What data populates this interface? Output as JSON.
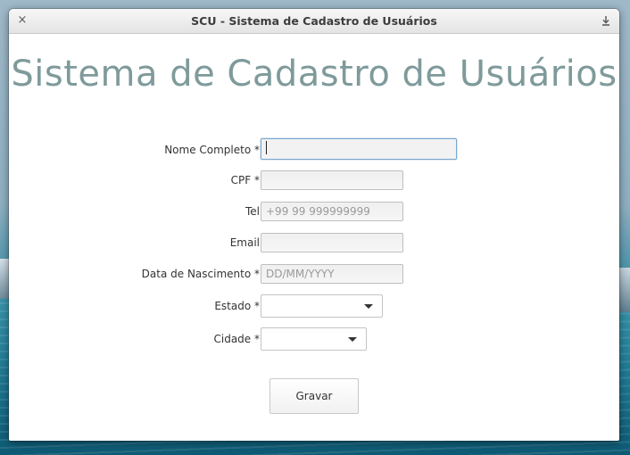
{
  "window": {
    "title": "SCU - Sistema de Cadastro de Usuários",
    "close_glyph": "×",
    "close_icon": "close-icon",
    "maximize_icon": "maximize-icon"
  },
  "heading": "Sistema de Cadastro de Usuários",
  "form": {
    "nome": {
      "label": "Nome Completo *",
      "value": "",
      "focused": true
    },
    "cpf": {
      "label": "CPF *",
      "value": ""
    },
    "tel": {
      "label": "Tel",
      "placeholder": "+99 99 999999999"
    },
    "email": {
      "label": "Email",
      "value": ""
    },
    "nascimento": {
      "label": "Data de Nascimento *",
      "placeholder": "DD/MM/YYYY"
    },
    "estado": {
      "label": "Estado *",
      "selected": ""
    },
    "cidade": {
      "label": "Cidade *",
      "selected": ""
    },
    "submit_label": "Gravar"
  },
  "colors": {
    "heading": "#7f9a9a",
    "focus_border": "#7aa7cf"
  }
}
